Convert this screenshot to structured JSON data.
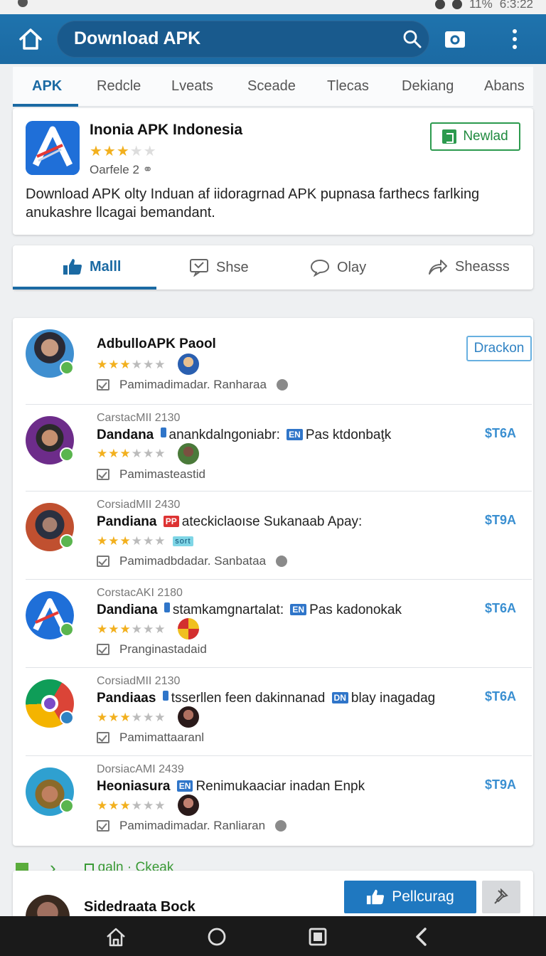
{
  "status": {
    "battery": "11%",
    "time": "6:3:22"
  },
  "app_bar": {
    "title": "Download APK"
  },
  "tabs": [
    {
      "label": "APK",
      "active": true
    },
    {
      "label": "Redcle"
    },
    {
      "label": "Lveats"
    },
    {
      "label": "Sceade"
    },
    {
      "label": "Tlecas"
    },
    {
      "label": "Dekiang"
    },
    {
      "label": "Abans"
    }
  ],
  "featured": {
    "title": "Inonia APK Indonesia",
    "rating": 3,
    "meta": "Oarfele 2",
    "button": "Newlad",
    "description": "Download APK olty Induan af iidoragrnad APK pupnasa farthecs farlking anukashre llcagai bemandant."
  },
  "actions": [
    {
      "label": "Malll",
      "active": true
    },
    {
      "label": "Shse"
    },
    {
      "label": "Olay"
    },
    {
      "label": "Sheasss"
    }
  ],
  "list": [
    {
      "category": "",
      "name": "AdbulloAPK Paool",
      "text": "",
      "rating": 3,
      "meta": "Pamimadimadar. Ranharaa",
      "right_button": "Drackon",
      "price": ""
    },
    {
      "category": "CarstacMII 2130",
      "name": "Dandana",
      "text": "anankdalngoniabr:",
      "tag": "EN",
      "text2": "Pas ktdonbaţk",
      "rating": 3,
      "meta": "Pamimasteastid",
      "price": "$T6A"
    },
    {
      "category": "CorsiadMII 2430",
      "name": "Pandiana",
      "tag": "PP",
      "text": "ateckiclaoıse Sukanaab Apay:",
      "rating": 3,
      "meta": "Pamimadbdadar. Sanbataa",
      "price": "$T9A"
    },
    {
      "category": "CorstacAKI 2180",
      "name": "Dandiana",
      "text": "stamkamgnartalat:",
      "tag": "EN",
      "text2": "Pas kadonokak",
      "rating": 3,
      "meta": "Pranginastadaid",
      "price": "$T6A"
    },
    {
      "category": "CorsiadMII 2130",
      "name": "Pandiaas",
      "text": "tsserllen feen dakinnanad",
      "tag": "DN",
      "text2": "blay inagadag",
      "rating": 3,
      "meta": "Pamimattaaranl",
      "price": "$T6A"
    },
    {
      "category": "DorsiacAMI 2439",
      "name": "Heoniasura",
      "tag": "EN",
      "text": "Renimukaaciar inadan Enpk",
      "rating": 3,
      "meta": "Pamimadimadar. Ranliaran",
      "price": "$T9A"
    }
  ],
  "section": {
    "link": "ɑaln · Ckeak"
  },
  "bottom_card": {
    "title": "Sidedraata Bock",
    "button": "Pellcurag"
  },
  "colors": {
    "primary": "#1b6aa3",
    "green": "#2c9a4e",
    "star": "#f2b01e",
    "price": "#3a8fd1"
  }
}
